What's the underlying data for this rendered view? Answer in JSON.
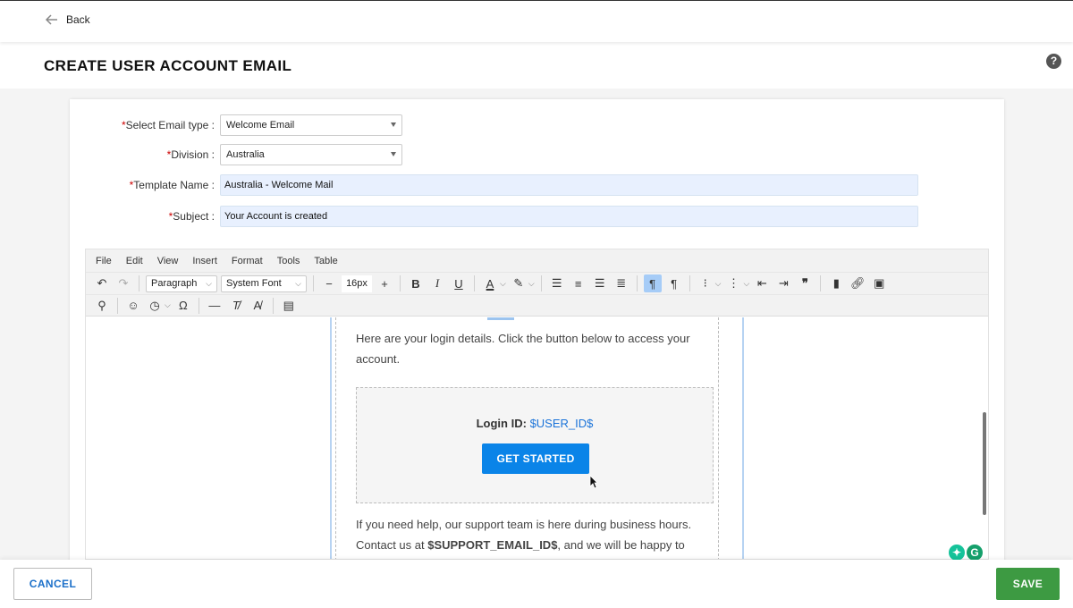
{
  "header": {
    "back_label": "Back",
    "title": "CREATE USER ACCOUNT EMAIL"
  },
  "form": {
    "email_type": {
      "label": "Select Email type :",
      "value": "Welcome Email"
    },
    "division": {
      "label": "Division :",
      "value": "Australia"
    },
    "template_name": {
      "label": "Template Name :",
      "value": "Australia - Welcome Mail"
    },
    "subject": {
      "label": "Subject :",
      "value": "Your Account is created"
    },
    "required_mark": "*"
  },
  "editor": {
    "menu": [
      "File",
      "Edit",
      "View",
      "Insert",
      "Format",
      "Tools",
      "Table"
    ],
    "block_format": "Paragraph",
    "font_family": "System Font",
    "font_size": "16px",
    "content": {
      "intro": "Here are your login details. Click the button below to access your account.",
      "login_label": "Login ID:",
      "login_var": "$USER_ID$",
      "cta_label": "GET STARTED",
      "help_text_1": "If you need help, our support team is here during business hours. Contact us at ",
      "support_var": "$SUPPORT_EMAIL_ID$",
      "help_text_2": ", and we will be happy to"
    }
  },
  "footer": {
    "cancel_label": "CANCEL",
    "save_label": "SAVE"
  },
  "colors": {
    "save": "#3d9a42",
    "cta": "#0a84e8",
    "link": "#1a73d9",
    "cancel_text": "#1a6fc9"
  },
  "icons": [
    "arrow-left-icon",
    "help-icon",
    "undo-icon",
    "redo-icon",
    "bold-icon",
    "italic-icon",
    "underline-icon",
    "text-color-icon",
    "highlight-icon",
    "align-left-icon",
    "align-center-icon",
    "align-right-icon",
    "justify-icon",
    "ltr-icon",
    "rtl-icon",
    "bullet-list-icon",
    "numbered-list-icon",
    "outdent-icon",
    "indent-icon",
    "blockquote-icon",
    "bookmark-icon",
    "link-icon",
    "image-icon",
    "search-icon",
    "emoji-icon",
    "clock-icon",
    "omega-icon",
    "horizontal-rule-icon",
    "clear-format-icon",
    "spellcheck-icon",
    "template-icon"
  ]
}
